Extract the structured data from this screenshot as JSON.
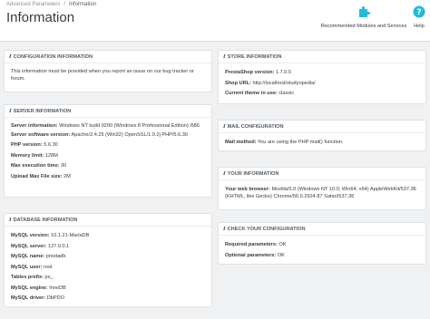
{
  "header": {
    "breadcrumb": {
      "parent": "Advanced Parameters",
      "separator": "/",
      "current": "Information"
    },
    "title": "Information",
    "toolbar": [
      {
        "label": "Recommended Modules and Services",
        "icon": "puzzle-icon"
      },
      {
        "label": "Help",
        "icon": "help-icon"
      }
    ]
  },
  "colors": {
    "accent": "#25b9d7",
    "panel_bg": "#ffffff",
    "page_bg": "#eff1f2"
  },
  "panels": {
    "config": {
      "heading": "Configuration Information",
      "text": "This information must be provided when you report an issue on our bug tracker or forum."
    },
    "server": {
      "heading": "Server Information",
      "rows": [
        {
          "label": "Server information:",
          "value": "Windows NT build 9200 (Windows 8 Professional Edition) i586"
        },
        {
          "label": "Server software version:",
          "value": "Apache/2.4.25 (Win32) OpenSSL/1.0.2j PHP/5.6.30"
        },
        {
          "label": "PHP version:",
          "value": "5.6.30"
        },
        {
          "label": "Memory limit:",
          "value": "128M"
        },
        {
          "label": "Max execution time:",
          "value": "30"
        },
        {
          "label": "Upload Max File size:",
          "value": "2M"
        }
      ]
    },
    "database": {
      "heading": "Database Information",
      "rows": [
        {
          "label": "MySQL version:",
          "value": "10.1.21-MariaDB"
        },
        {
          "label": "MySQL server:",
          "value": "127.0.0.1"
        },
        {
          "label": "MySQL name:",
          "value": "prestadb"
        },
        {
          "label": "MySQL user:",
          "value": "root"
        },
        {
          "label": "Tables prefix:",
          "value": "ps_"
        },
        {
          "label": "MySQL engine:",
          "value": "InnoDB"
        },
        {
          "label": "MySQL driver:",
          "value": "DbPDO"
        }
      ]
    },
    "store": {
      "heading": "Store Information",
      "rows": [
        {
          "label": "PrestaShop version:",
          "value": "1.7.0.5"
        },
        {
          "label": "Shop URL:",
          "value": "http://localhost/studyopedia/"
        },
        {
          "label": "Current theme in use:",
          "value": "classic"
        }
      ]
    },
    "mail": {
      "heading": "Mail Configuration",
      "rows": [
        {
          "label": "Mail method:",
          "value": "You are using the PHP mail() function."
        }
      ]
    },
    "user": {
      "heading": "Your Information",
      "rows": [
        {
          "label": "Your web browser:",
          "value": "Mozilla/5.0 (Windows NT 10.0; Win64; x64) AppleWebKit/537.36 (KHTML, like Gecko) Chrome/56.0.2924.87 Safari/537.36"
        }
      ]
    },
    "check": {
      "heading": "Check your configuration",
      "rows": [
        {
          "label": "Required parameters:",
          "value": "OK"
        },
        {
          "label": "Optional parameters:",
          "value": "OK"
        }
      ]
    }
  }
}
